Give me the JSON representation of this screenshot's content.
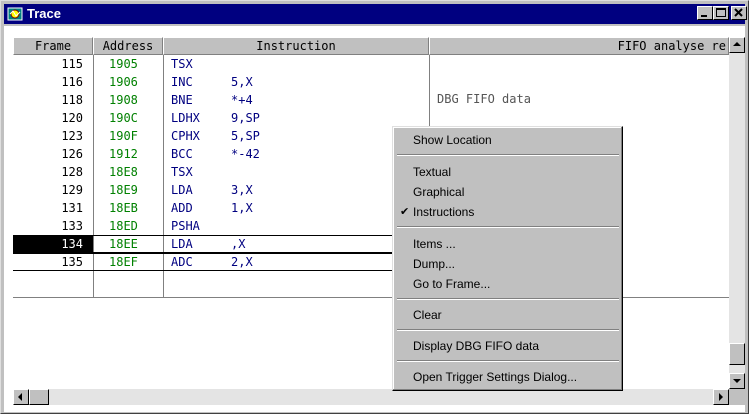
{
  "window": {
    "title": "Trace"
  },
  "table": {
    "columns": {
      "frame": "Frame",
      "address": "Address",
      "instruction": "Instruction",
      "fifo": "FIFO analyse re"
    },
    "rows": [
      {
        "frame": "115",
        "address": "1905",
        "mnemonic": "TSX",
        "operand": ""
      },
      {
        "frame": "116",
        "address": "1906",
        "mnemonic": "INC",
        "operand": "5,X"
      },
      {
        "frame": "118",
        "address": "1908",
        "mnemonic": "BNE",
        "operand": "*+4"
      },
      {
        "frame": "120",
        "address": "190C",
        "mnemonic": "LDHX",
        "operand": "9,SP"
      },
      {
        "frame": "123",
        "address": "190F",
        "mnemonic": "CPHX",
        "operand": "5,SP"
      },
      {
        "frame": "126",
        "address": "1912",
        "mnemonic": "BCC",
        "operand": "*-42"
      },
      {
        "frame": "128",
        "address": "18E8",
        "mnemonic": "TSX",
        "operand": ""
      },
      {
        "frame": "129",
        "address": "18E9",
        "mnemonic": "LDA",
        "operand": "3,X"
      },
      {
        "frame": "131",
        "address": "18EB",
        "mnemonic": "ADD",
        "operand": "1,X"
      },
      {
        "frame": "133",
        "address": "18ED",
        "mnemonic": "PSHA",
        "operand": ""
      },
      {
        "frame": "134",
        "address": "18EE",
        "mnemonic": "LDA",
        "operand": ",X"
      },
      {
        "frame": "135",
        "address": "18EF",
        "mnemonic": "ADC",
        "operand": "2,X"
      }
    ],
    "selected_frame": "134",
    "fifo_text": "DBG FIFO data"
  },
  "context_menu": {
    "show_location": "Show Location",
    "textual": "Textual",
    "graphical": "Graphical",
    "instructions": "Instructions",
    "instructions_checked": true,
    "check_mark": "✔",
    "items": "Items ...",
    "dump": "Dump...",
    "go_to_frame": "Go to Frame...",
    "clear": "Clear",
    "display_dbg": "Display DBG FIFO data",
    "open_trigger": "Open Trigger Settings Dialog..."
  },
  "colors": {
    "titlebar": "#000080",
    "address_text": "#008000",
    "instruction_text": "#000080",
    "selection": "#000000"
  },
  "icons": {
    "app": "trace-app-icon",
    "minimize": "minimize-icon",
    "maximize": "maximize-icon",
    "close": "close-icon"
  }
}
